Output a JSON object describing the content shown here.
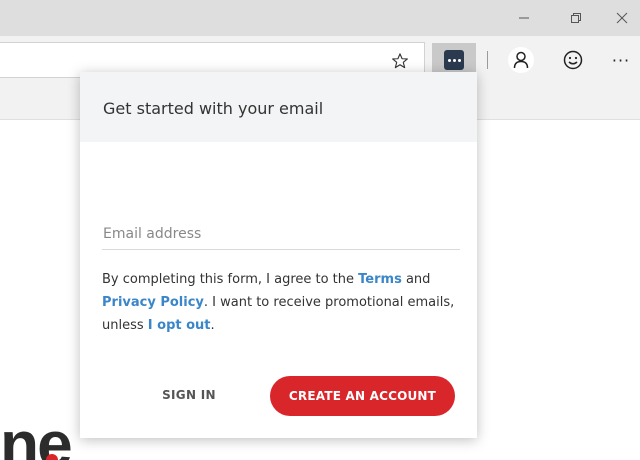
{
  "browser": {
    "window_controls": {
      "minimize_icon": "minimize-icon",
      "restore_icon": "restore-icon",
      "close_icon": "close-icon"
    },
    "toolbar": {
      "favorite_icon": "star-icon",
      "extension_icon": "password-manager-icon",
      "profile_icon": "person-icon",
      "feedback_icon": "smiley-icon",
      "more_label": "···"
    }
  },
  "page": {
    "fragment_text": "ne"
  },
  "popup": {
    "title": "Get started with your email",
    "email_placeholder": "Email address",
    "email_value": "",
    "consent": {
      "part1": "By completing this form, I agree to the ",
      "terms_link": "Terms",
      "part2": " and ",
      "privacy_link": "Privacy Policy",
      "part3": ". I want to receive promotional emails, unless ",
      "optout_link": "I opt out",
      "part4": "."
    },
    "sign_in_label": "SIGN IN",
    "create_account_label": "CREATE AN ACCOUNT"
  },
  "colors": {
    "accent": "#d8262b",
    "link": "#3a86c8",
    "header_bg": "#f3f4f6",
    "extension_badge": "#2b3a4f"
  }
}
